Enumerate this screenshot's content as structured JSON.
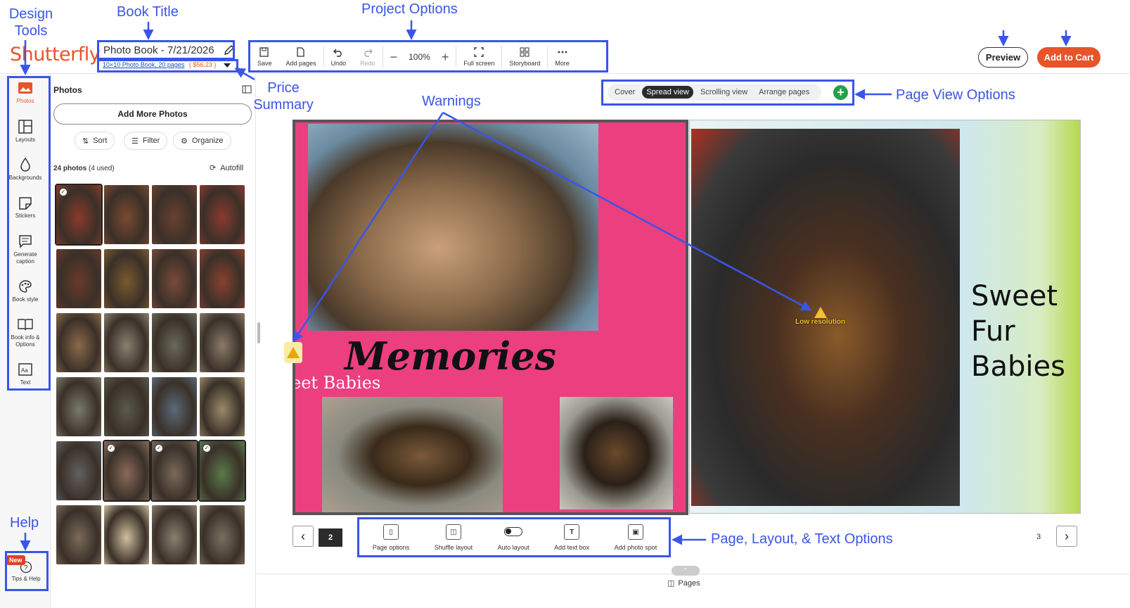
{
  "annotations": {
    "design_tools": "Design Tools",
    "book_title": "Book Title",
    "project_options": "Project Options",
    "price_summary": "Price Summary",
    "warnings": "Warnings",
    "page_view_options": "Page View Options",
    "page_layout_text_options": "Page, Layout, & Text Options",
    "help": "Help"
  },
  "header": {
    "logo": "Shutterfly",
    "book_title": "Photo Book - 7/21/2026",
    "book_format": "10×10 Photo Book, 20 pages",
    "price": "( $56.23 )",
    "preview": "Preview",
    "add_to_cart": "Add to Cart"
  },
  "toolbar": {
    "save": "Save",
    "add_pages": "Add pages",
    "undo": "Undo",
    "redo": "Redo",
    "zoom": "100%",
    "full_screen": "Full screen",
    "storyboard": "Storyboard",
    "more": "More"
  },
  "rail": {
    "photos": "Photos",
    "layouts": "Layouts",
    "backgrounds": "Backgrounds",
    "stickers": "Stickers",
    "generate_caption_1": "Generate",
    "generate_caption_2": "caption",
    "book_style": "Book style",
    "book_info_1": "Book info &",
    "book_info_2": "Options",
    "text": "Text",
    "new_badge": "New",
    "tips_help": "Tips & Help"
  },
  "panel": {
    "title": "Photos",
    "add_more": "Add More Photos",
    "sort": "Sort",
    "filter": "Filter",
    "organize": "Organize",
    "count_bold": "24 photos",
    "count_rest": " (4 used)",
    "autofill": "Autofill",
    "thumb_colors": [
      "#8a3a2a",
      "#7a4a30",
      "#6a4030",
      "#8a3a30",
      "#6a3a2a",
      "#7a5a30",
      "#7a4a3a",
      "#8a4030",
      "#8a6a4a",
      "#8a8070",
      "#6a6a5a",
      "#8a7a6a",
      "#7a7a6a",
      "#5a5a4a",
      "#5a6a7a",
      "#9a8a6a",
      "#606060",
      "#8a6a5a",
      "#7a6a5a",
      "#5a7a4a",
      "#7a6a5a",
      "#d0c0a0",
      "#8a8070",
      "#7a7060"
    ],
    "selected": [
      0,
      17,
      18,
      19
    ]
  },
  "view_options": {
    "cover": "Cover",
    "spread": "Spread view",
    "scrolling": "Scrolling view",
    "arrange": "Arrange pages"
  },
  "spread": {
    "memories": "Memories",
    "sweet_babies": "eet Babies",
    "sweet": "Sweet",
    "fur": "Fur",
    "babies": "Babies",
    "low_resolution": "Low resolution",
    "page_left": "2",
    "page_right": "3"
  },
  "page_tools": {
    "page_options": "Page options",
    "shuffle_layout": "Shuffle layout",
    "auto_layout": "Auto layout",
    "add_text_box": "Add text box",
    "add_photo_spot": "Add photo spot"
  },
  "footer": {
    "pages": "Pages"
  }
}
